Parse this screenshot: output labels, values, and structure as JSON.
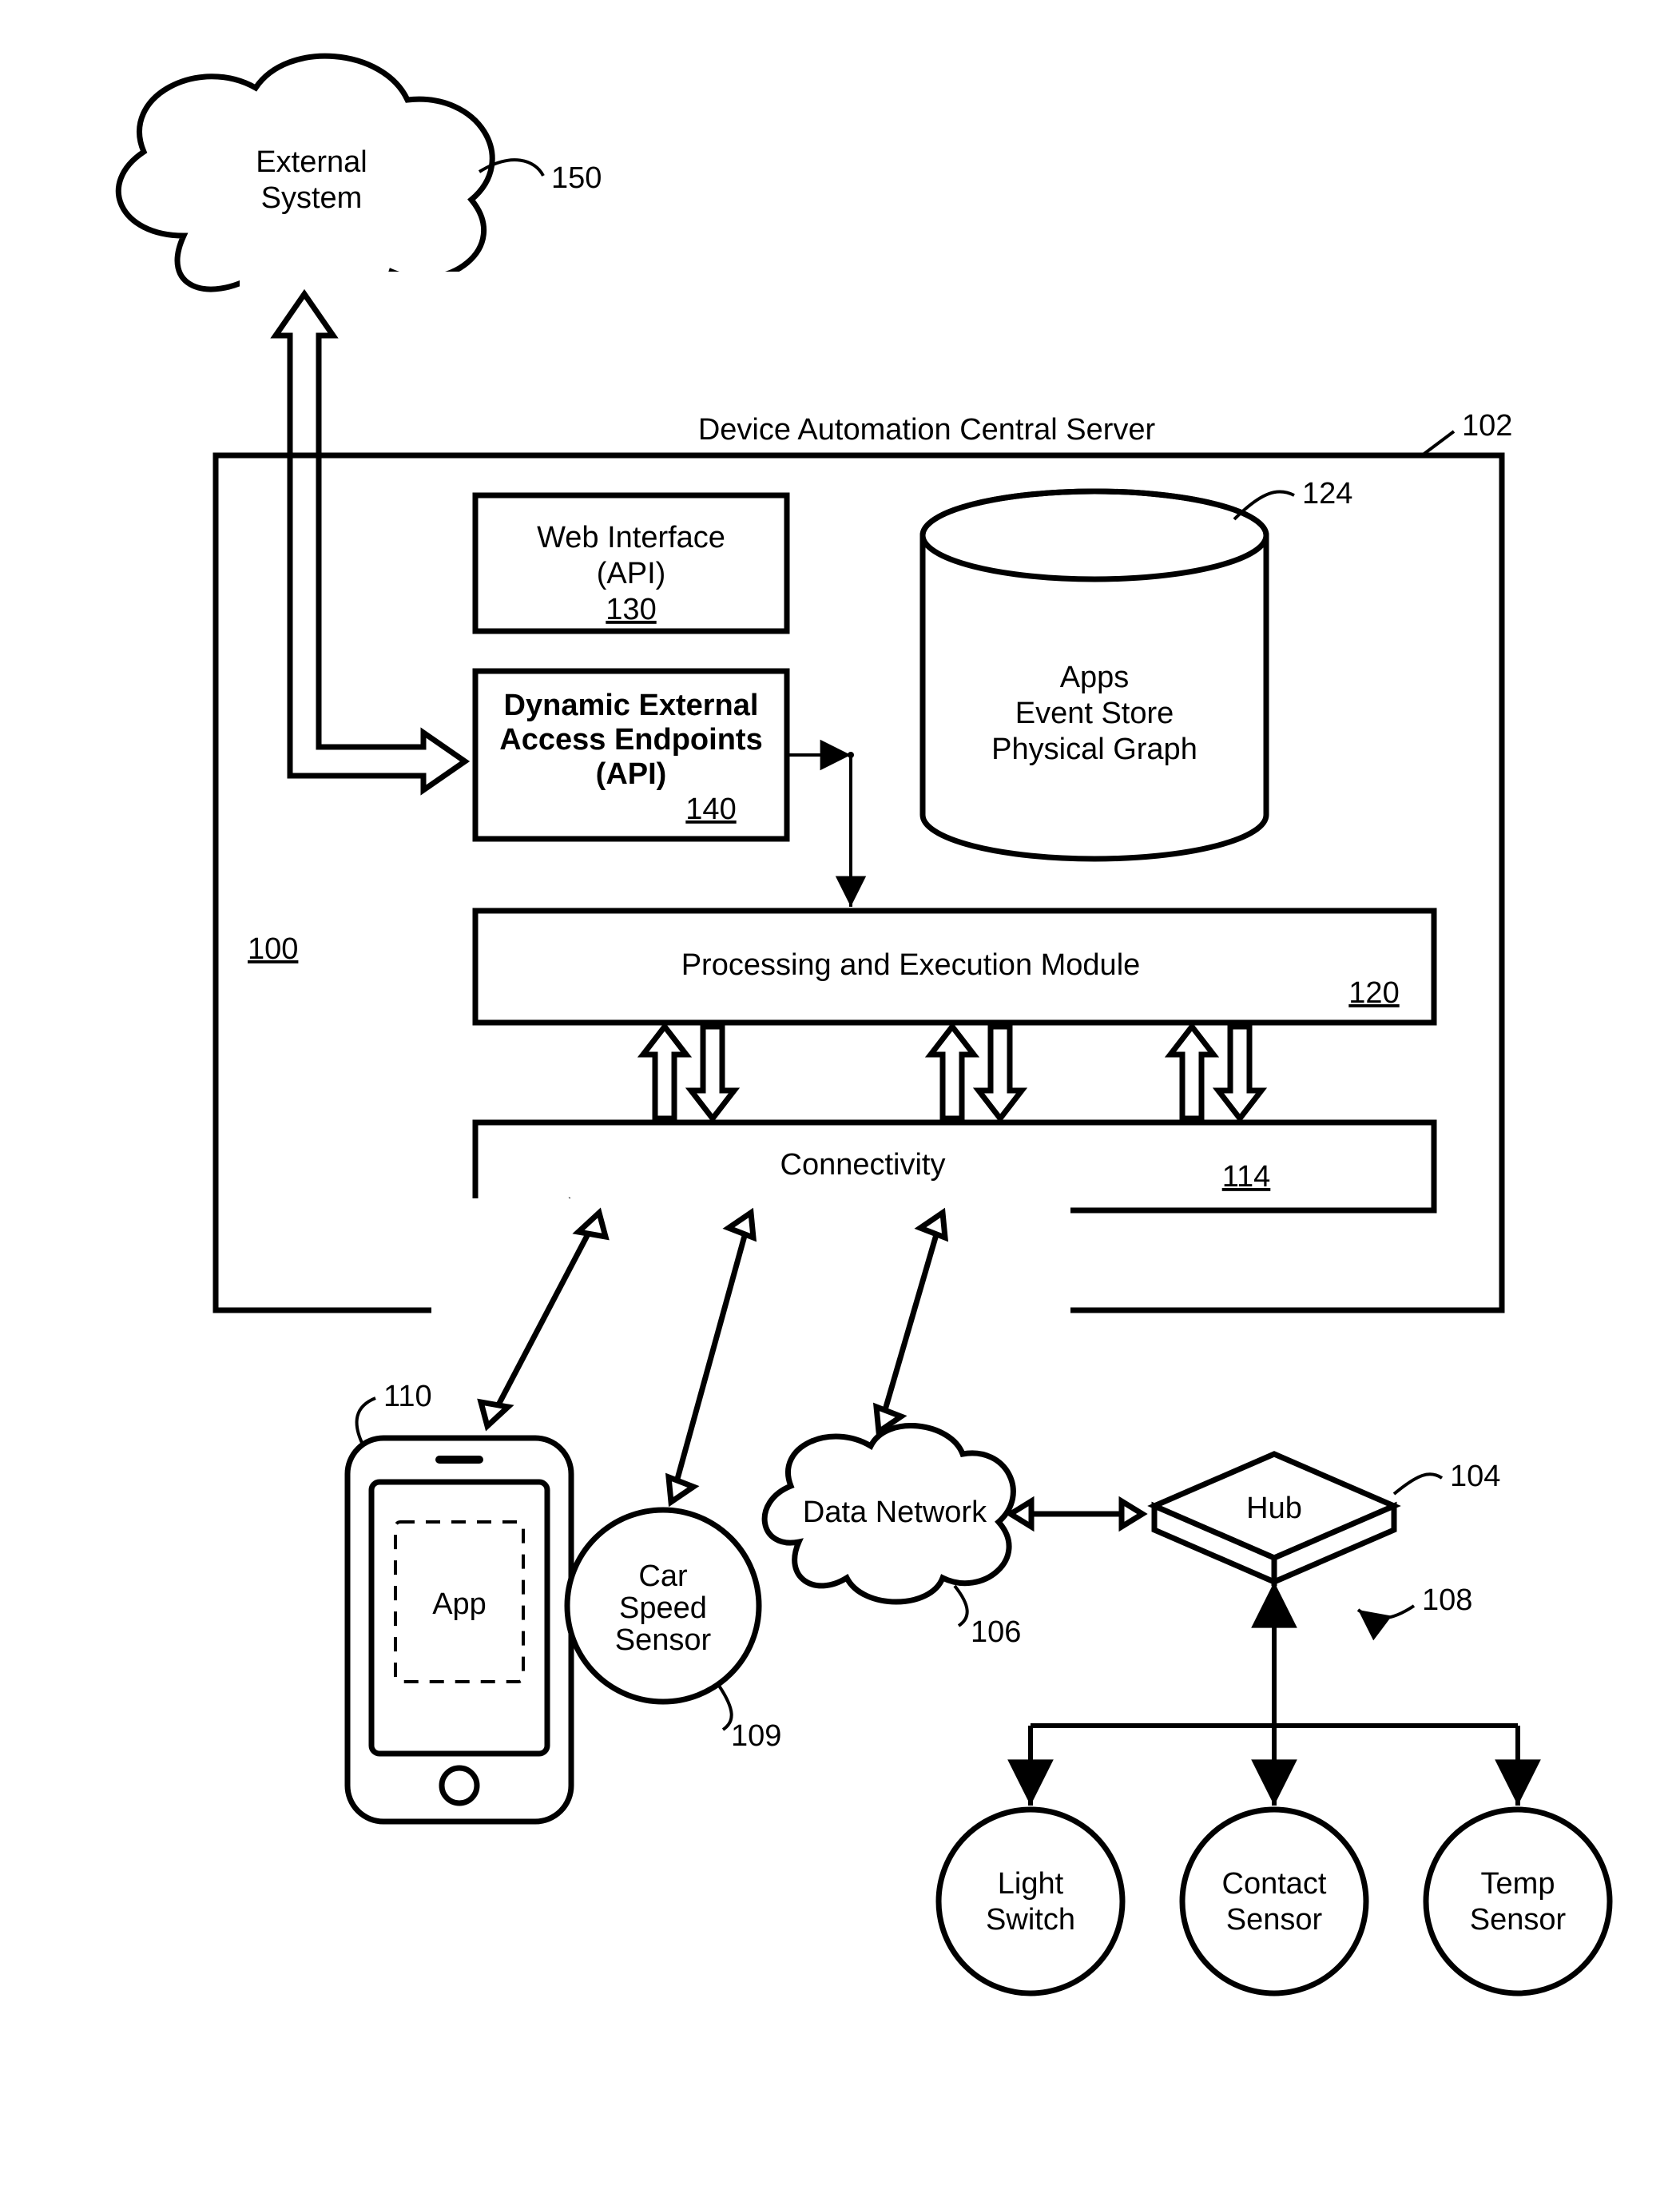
{
  "external_system": {
    "line1": "External",
    "line2": "System",
    "ref": "150"
  },
  "server": {
    "title": "Device Automation Central Server",
    "ref": "102",
    "web_api": {
      "line1": "Web Interface",
      "line2": "(API)",
      "ref": "130"
    },
    "endpoints": {
      "line1": "Dynamic External",
      "line2": "Access Endpoints",
      "line3": "(API)",
      "ref": "140"
    },
    "store": {
      "line1": "Apps",
      "line2": "Event Store",
      "line3": "Physical Graph",
      "ref": "124"
    },
    "proc": {
      "label": "Processing and Execution Module",
      "ref": "120"
    },
    "conn": {
      "label": "Connectivity",
      "ref": "114"
    }
  },
  "system_ref": "100",
  "phone": {
    "app": "App",
    "ref": "110"
  },
  "car_sensor": {
    "line1": "Car",
    "line2": "Speed",
    "line3": "Sensor",
    "ref": "109"
  },
  "data_network": {
    "label": "Data Network",
    "ref": "106"
  },
  "hub": {
    "label": "Hub",
    "ref": "104"
  },
  "devices_ref": "108",
  "light": {
    "line1": "Light",
    "line2": "Switch"
  },
  "contact": {
    "line1": "Contact",
    "line2": "Sensor"
  },
  "temp": {
    "line1": "Temp",
    "line2": "Sensor"
  }
}
